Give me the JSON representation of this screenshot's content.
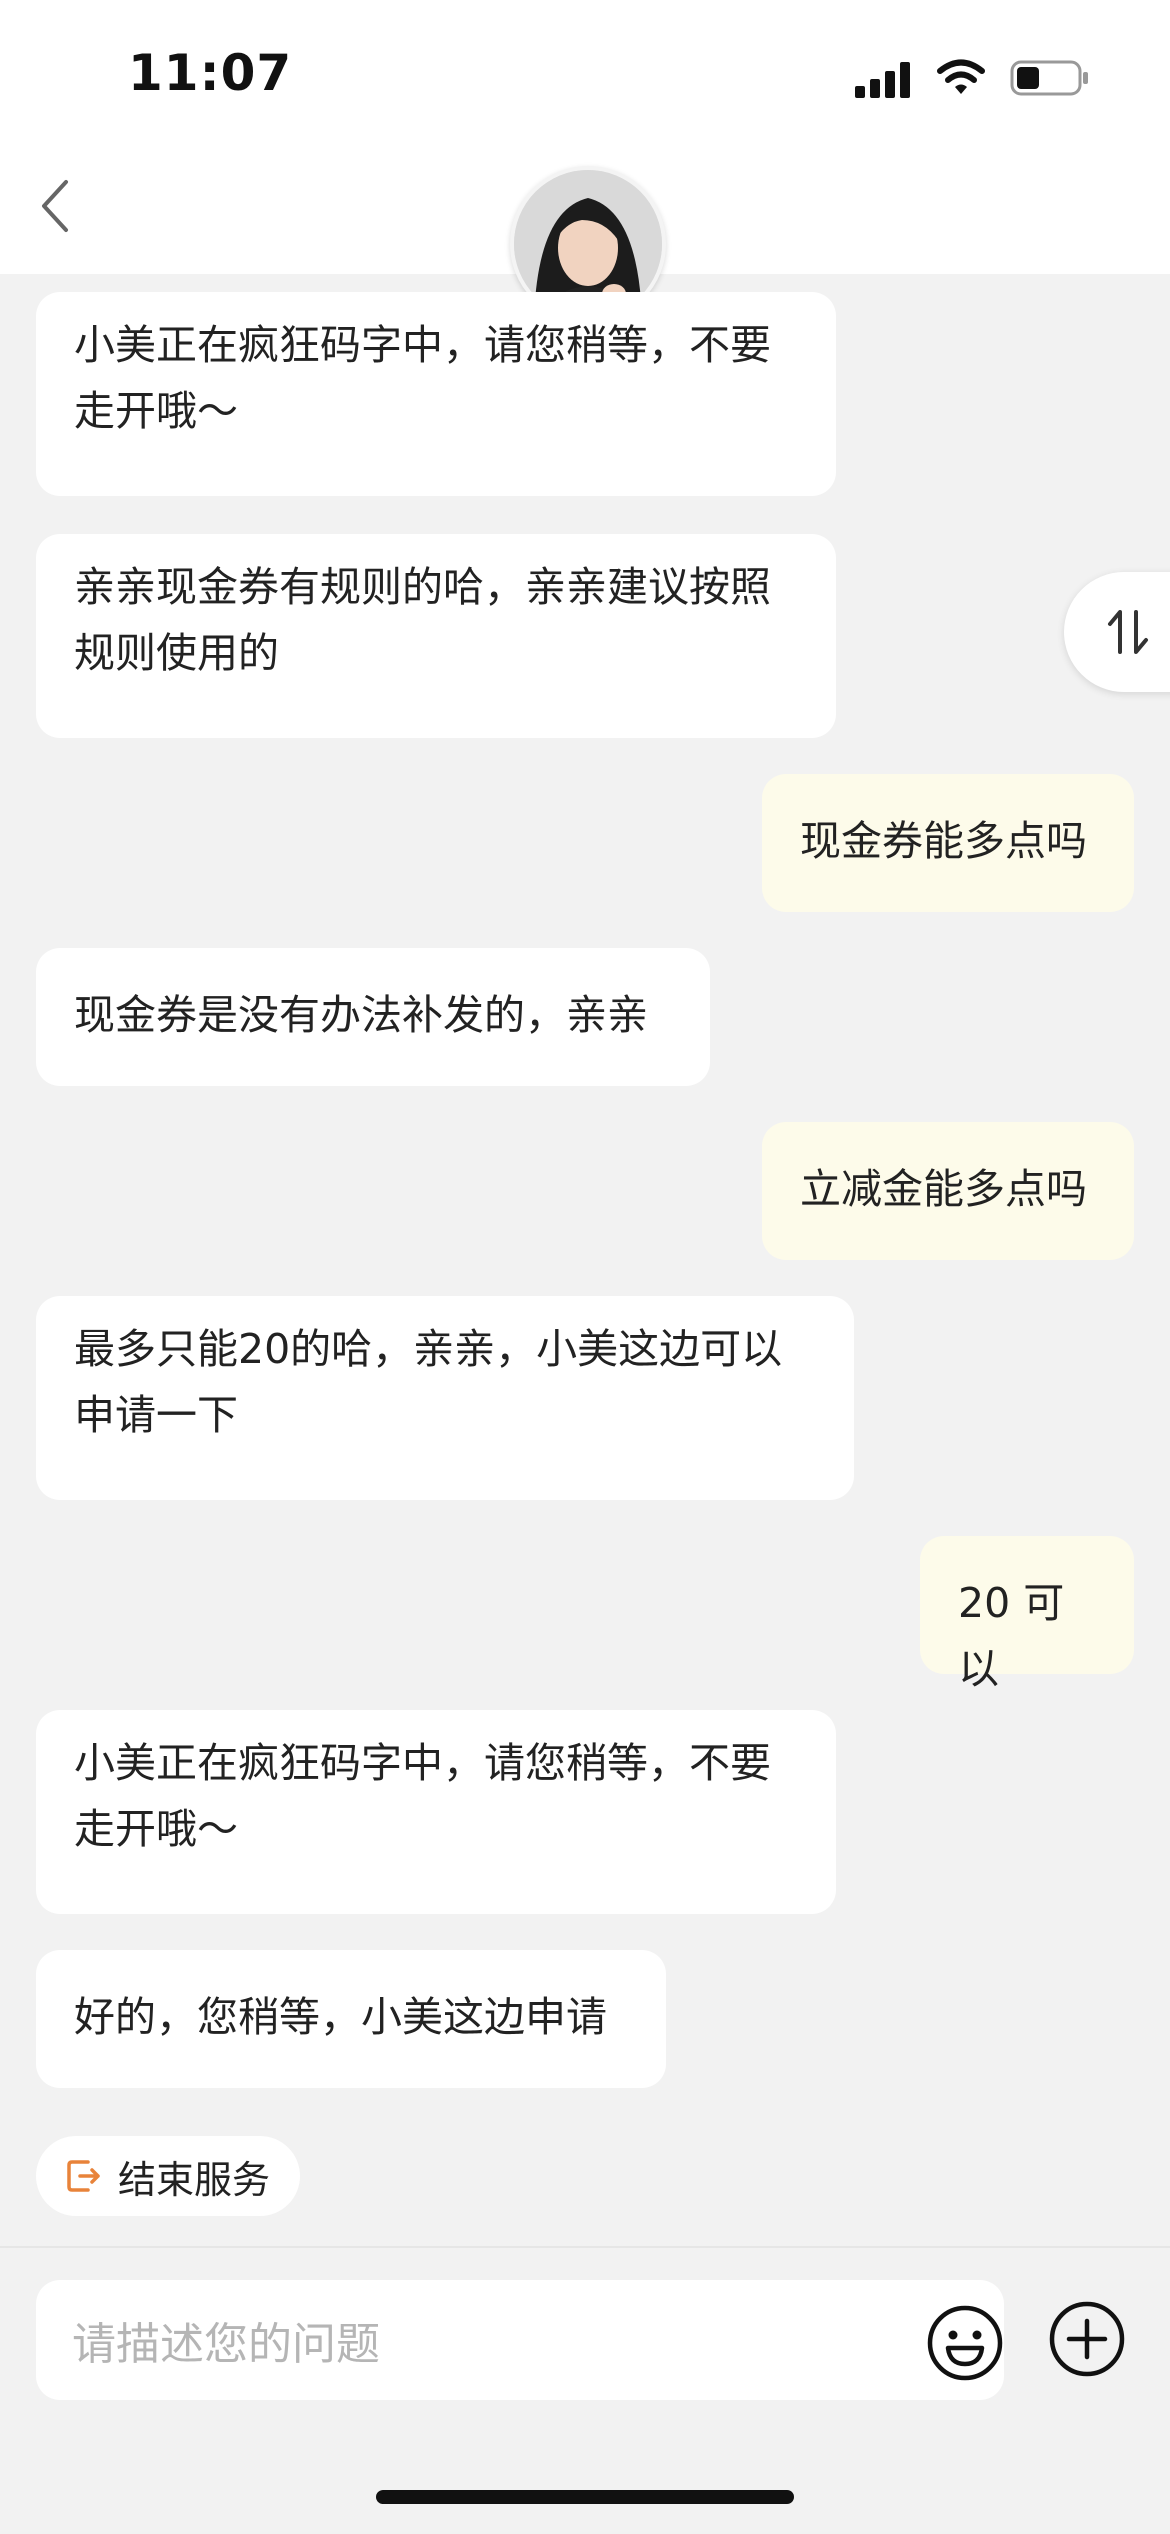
{
  "status_bar": {
    "time": "11:07"
  },
  "messages": [
    {
      "role": "agent",
      "text": "小美正在疯狂码字中，请您稍等，不要走开哦～"
    },
    {
      "role": "agent",
      "text": "亲亲现金券有规则的哈，亲亲建议按照规则使用的"
    },
    {
      "role": "user",
      "text": "现金券能多点吗"
    },
    {
      "role": "agent",
      "text": "现金券是没有办法补发的，亲亲"
    },
    {
      "role": "user",
      "text": "立减金能多点吗"
    },
    {
      "role": "agent",
      "text": "最多只能20的哈，亲亲，小美这边可以申请一下"
    },
    {
      "role": "user",
      "text": "20 可以"
    },
    {
      "role": "agent",
      "text": "小美正在疯狂码字中，请您稍等，不要走开哦～"
    },
    {
      "role": "agent",
      "text": "好的，您稍等，小美这边申请"
    }
  ],
  "end_service": {
    "label": "结束服务"
  },
  "input": {
    "placeholder": "请描述您的问题"
  },
  "icons": {
    "back": "chevron-left-icon",
    "sort": "swap-vertical-icon",
    "end": "exit-icon",
    "emoji": "smile-icon",
    "plus": "plus-circle-icon"
  },
  "colors": {
    "agent_bubble": "#ffffff",
    "user_bubble": "#fdfbea",
    "accent": "#e8833a",
    "background": "#f2f2f2"
  }
}
